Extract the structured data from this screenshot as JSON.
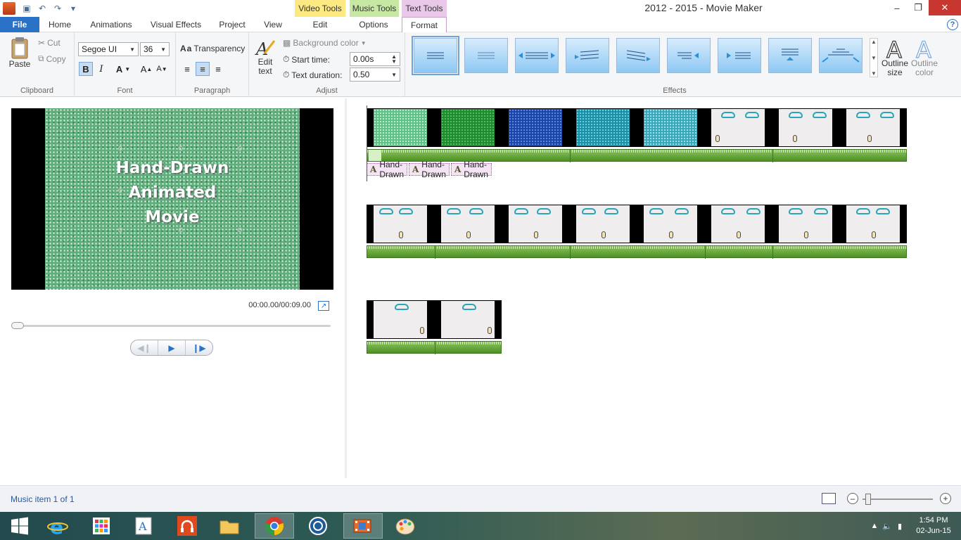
{
  "window": {
    "title": "2012 - 2015 - Movie Maker"
  },
  "context_tabs": {
    "video": "Video Tools",
    "music": "Music Tools",
    "text": "Text Tools"
  },
  "tabs": {
    "file": "File",
    "home": "Home",
    "animations": "Animations",
    "visual_effects": "Visual Effects",
    "project": "Project",
    "view": "View",
    "edit": "Edit",
    "options": "Options",
    "format": "Format"
  },
  "ribbon": {
    "clipboard": {
      "paste": "Paste",
      "cut": "Cut",
      "copy": "Copy",
      "label": "Clipboard"
    },
    "font": {
      "family": "Segoe UI",
      "size": "36",
      "label": "Font"
    },
    "paragraph": {
      "transparency": "Transparency",
      "label": "Paragraph"
    },
    "adjust": {
      "edit_text": "Edit\ntext",
      "background_color": "Background color",
      "start_time_label": "Start time:",
      "start_time_value": "0.00s",
      "text_duration_label": "Text duration:",
      "text_duration_value": "0.50",
      "label": "Adjust"
    },
    "effects": {
      "label": "Effects",
      "outline_size": "Outline\nsize",
      "outline_color": "Outline\ncolor"
    }
  },
  "preview": {
    "caption": "Hand-Drawn\nAnimated\nMovie",
    "timecode": "00:00.00/00:09.00"
  },
  "storyboard": {
    "captions": [
      "Hand-Drawn",
      "Hand-Drawn",
      "Hand-Drawn"
    ]
  },
  "status": {
    "text": "Music item 1 of 1"
  },
  "taskbar": {
    "time": "1:54 PM",
    "date": "02-Jun-15"
  },
  "colors": {
    "file_tab": "#2a72c8",
    "video_tools": "#fce982",
    "music_tools": "#c6e8a2",
    "text_tools": "#e8c7e8"
  }
}
